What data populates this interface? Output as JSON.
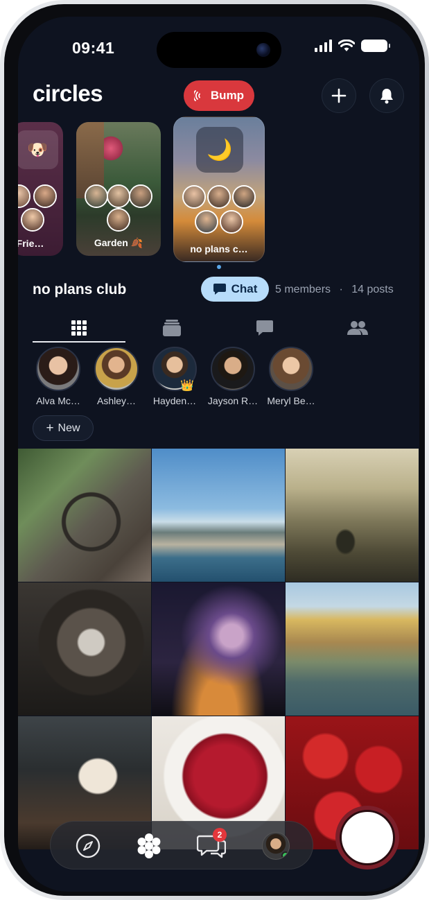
{
  "status_bar": {
    "time": "09:41"
  },
  "header": {
    "brand": "circles",
    "bump_label": "Bump"
  },
  "carousel": {
    "cards": [
      {
        "label": "y Frie…",
        "emoji": "🐶"
      },
      {
        "label": "Garden",
        "emoji": "🍂"
      },
      {
        "label": "no plans c…",
        "emoji": "🌙"
      }
    ]
  },
  "circle": {
    "name": "no plans club",
    "chat_label": "Chat",
    "members_count": "5 members",
    "separator": "·",
    "posts_count": "14 posts"
  },
  "members": [
    {
      "name": "Alva Mc…"
    },
    {
      "name": "Ashley…"
    },
    {
      "name": "Hayden…",
      "crown": "👑"
    },
    {
      "name": "Jayson R…"
    },
    {
      "name": "Meryl Be…"
    }
  ],
  "new_button": {
    "plus": "+",
    "label": "New"
  },
  "bottom_nav": {
    "chat_badge": "2"
  },
  "colors": {
    "background": "#0e1320",
    "bump": "#d9383d",
    "chat": "#b7dcfa",
    "badge": "#e3373c",
    "online": "#37c45b"
  }
}
